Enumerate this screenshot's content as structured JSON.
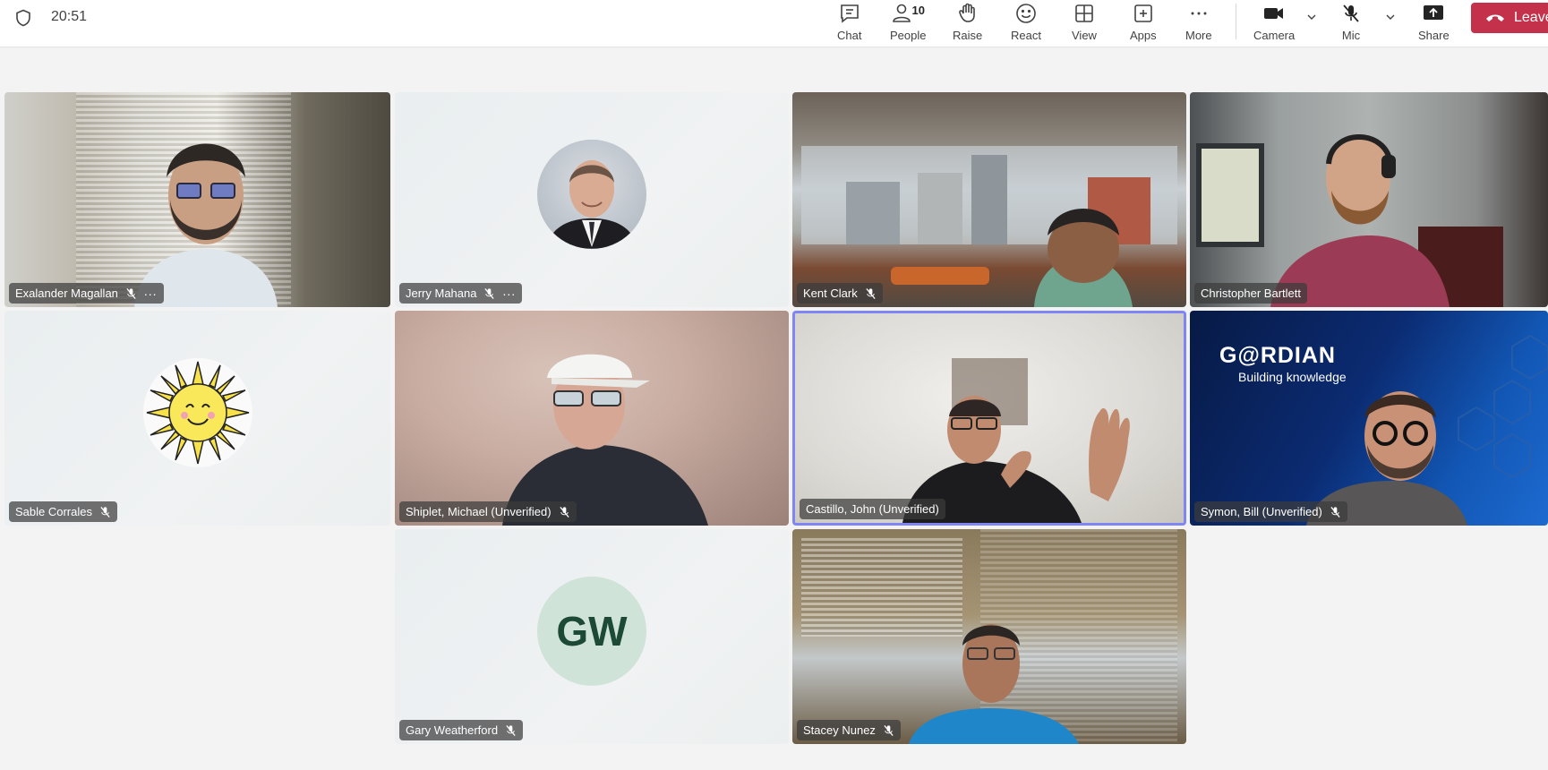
{
  "status": {
    "time": "20:51"
  },
  "toolbar": {
    "chat": "Chat",
    "people": "People",
    "people_count": "10",
    "raise": "Raise",
    "react": "React",
    "view": "View",
    "apps": "Apps",
    "more": "More",
    "camera": "Camera",
    "mic": "Mic",
    "share": "Share",
    "leave": "Leave"
  },
  "participants": [
    {
      "name": "Exalander Magallan",
      "muted": true,
      "has_more_menu": true
    },
    {
      "name": "Jerry Mahana",
      "muted": true,
      "has_more_menu": true
    },
    {
      "name": "Kent Clark",
      "muted": true
    },
    {
      "name": "Christopher Bartlett",
      "muted": false
    },
    {
      "name": "Sable Corrales",
      "muted": true
    },
    {
      "name": "Shiplet, Michael (Unverified)",
      "muted": true
    },
    {
      "name": "Castillo, John (Unverified)",
      "muted": false,
      "active_speaker": true
    },
    {
      "name": "Symon, Bill (Unverified)",
      "muted": true
    },
    {
      "name": "Gary Weatherford",
      "muted": true,
      "initials": "GW"
    },
    {
      "name": "Stacey Nunez",
      "muted": true
    }
  ],
  "symon_background": {
    "brand": "G@RDIAN",
    "tagline": "Building knowledge"
  },
  "colors": {
    "leave": "#c4314b",
    "active_border": "#7f85f5",
    "avatar_gw_bg": "#cfe3d8",
    "avatar_gw_text": "#1d4a35"
  }
}
